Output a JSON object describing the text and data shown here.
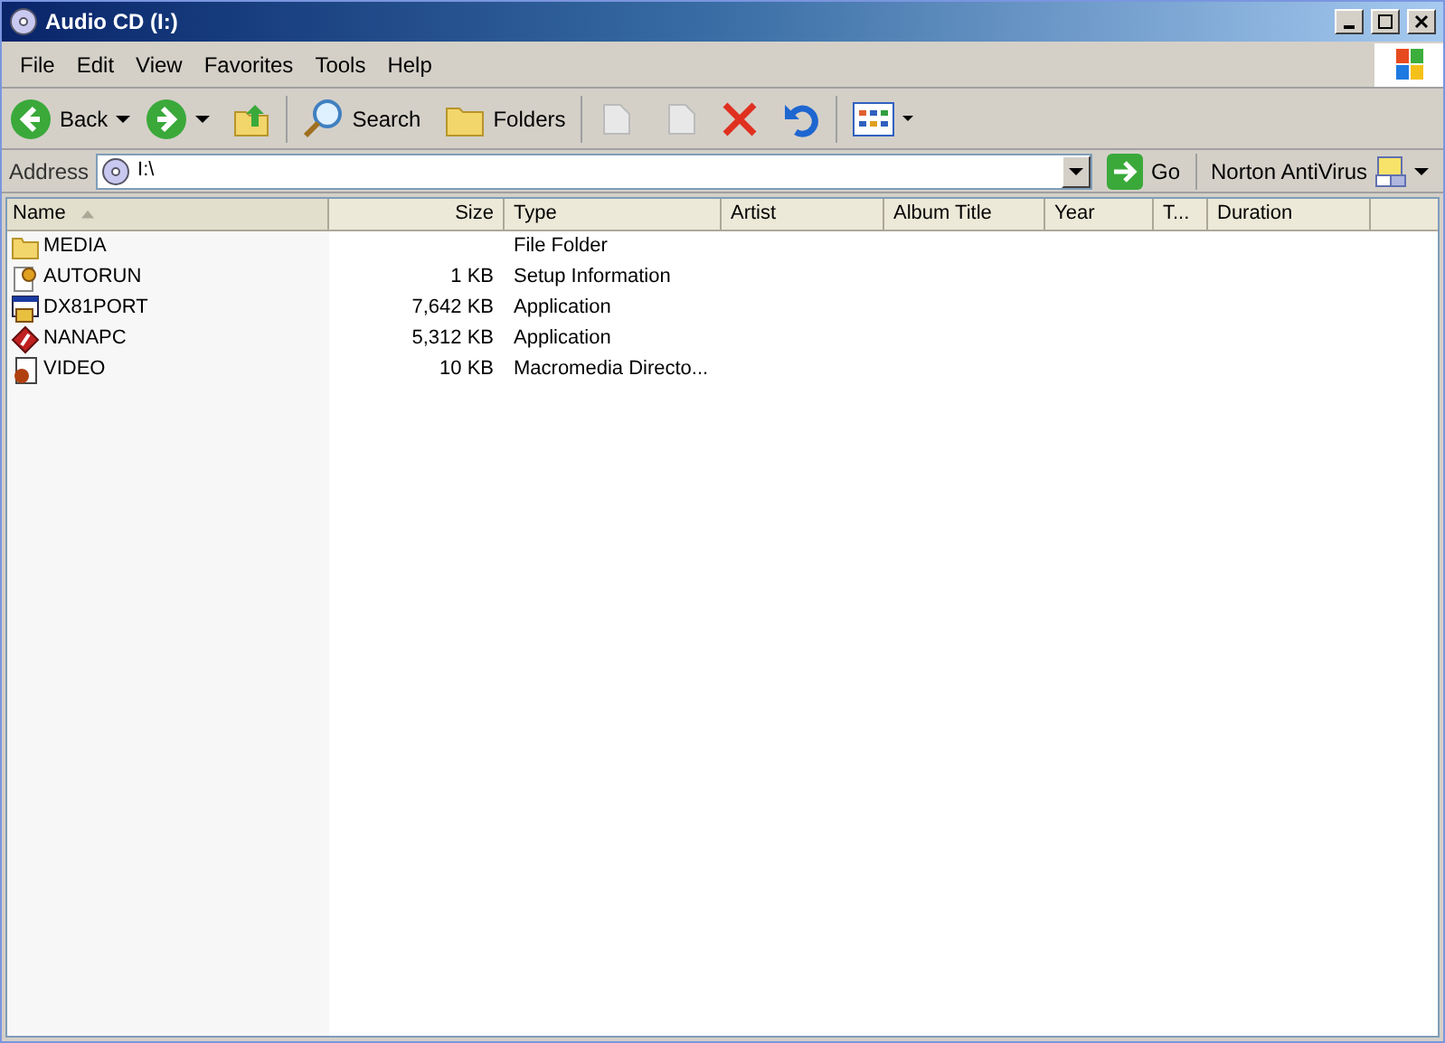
{
  "window": {
    "title": "Audio CD (I:)"
  },
  "menu": [
    "File",
    "Edit",
    "View",
    "Favorites",
    "Tools",
    "Help"
  ],
  "toolbar": {
    "back": "Back",
    "search": "Search",
    "folders": "Folders"
  },
  "address": {
    "label": "Address",
    "value": "I:\\",
    "go": "Go",
    "norton": "Norton AntiVirus"
  },
  "columns": [
    {
      "label": "Name",
      "sorted": true
    },
    {
      "label": "Size",
      "sorted": false
    },
    {
      "label": "Type",
      "sorted": false
    },
    {
      "label": "Artist",
      "sorted": false
    },
    {
      "label": "Album Title",
      "sorted": false
    },
    {
      "label": "Year",
      "sorted": false
    },
    {
      "label": "T...",
      "sorted": false
    },
    {
      "label": "Duration",
      "sorted": false
    }
  ],
  "rows": [
    {
      "kind": "folder",
      "name": "MEDIA",
      "size": "",
      "type": "File Folder"
    },
    {
      "kind": "setup",
      "name": "AUTORUN",
      "size": "1 KB",
      "type": "Setup Information"
    },
    {
      "kind": "app",
      "name": "DX81PORT",
      "size": "7,642 KB",
      "type": "Application"
    },
    {
      "kind": "flash",
      "name": "NANAPC",
      "size": "5,312 KB",
      "type": "Application"
    },
    {
      "kind": "director",
      "name": "VIDEO",
      "size": "10 KB",
      "type": "Macromedia Directo..."
    }
  ]
}
